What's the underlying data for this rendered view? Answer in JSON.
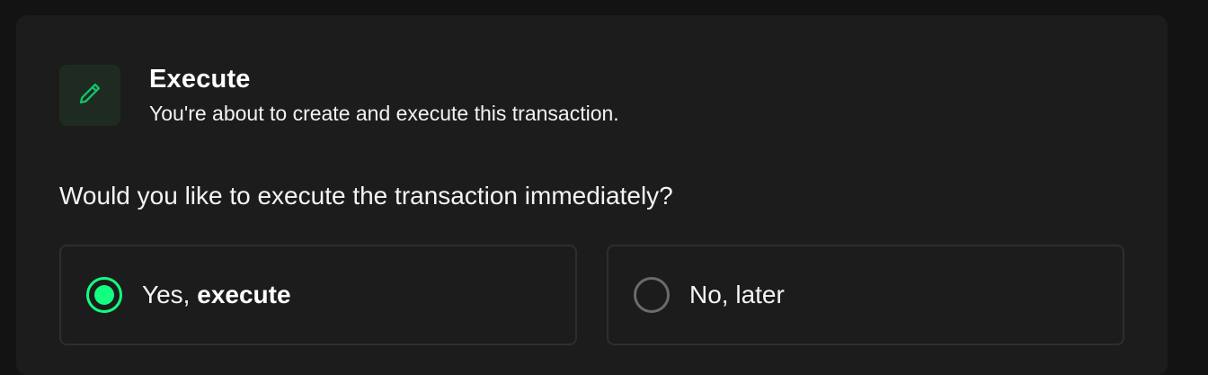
{
  "header": {
    "icon": "pencil-icon",
    "title": "Execute",
    "subtitle": "You're about to create and execute this transaction."
  },
  "question": "Would you like to execute the transaction immediately?",
  "options": [
    {
      "prefix": "Yes, ",
      "emphasis": "execute",
      "selected": true
    },
    {
      "prefix": "No, later",
      "emphasis": "",
      "selected": false
    }
  ],
  "colors": {
    "accent": "#12ff80",
    "card_background": "#1c1c1c",
    "page_background": "#121312"
  }
}
